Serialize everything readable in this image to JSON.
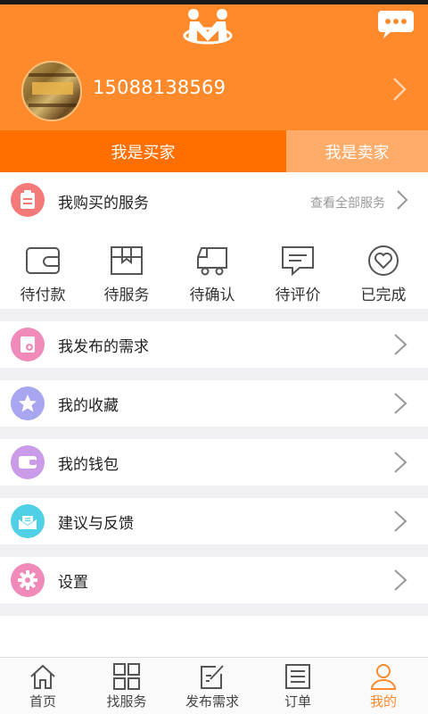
{
  "header": {
    "phone": "15088138569"
  },
  "role_tabs": [
    {
      "label": "我是买家",
      "active": true
    },
    {
      "label": "我是卖家",
      "active": false
    }
  ],
  "purchased": {
    "title": "我购买的服务",
    "view_all": "查看全部服务"
  },
  "status_items": [
    {
      "label": "待付款",
      "icon": "wallet-icon"
    },
    {
      "label": "待服务",
      "icon": "package-icon"
    },
    {
      "label": "待确认",
      "icon": "truck-icon"
    },
    {
      "label": "待评价",
      "icon": "comment-icon"
    },
    {
      "label": "已完成",
      "icon": "heart-check-icon"
    }
  ],
  "menu": [
    {
      "label": "我发布的需求",
      "icon": "publish-icon",
      "color": "#f08bb9"
    },
    {
      "label": "我的收藏",
      "icon": "star-icon",
      "color": "#a8a6f0"
    },
    {
      "label": "我的钱包",
      "icon": "wallet-icon",
      "color": "#c99be8"
    },
    {
      "label": "建议与反馈",
      "icon": "mail-icon",
      "color": "#4fd0e6"
    },
    {
      "label": "设置",
      "icon": "gear-icon",
      "color": "#f08bb9"
    }
  ],
  "bottom_nav": [
    {
      "label": "首页",
      "icon": "home-icon",
      "active": false
    },
    {
      "label": "找服务",
      "icon": "grid-icon",
      "active": false
    },
    {
      "label": "发布需求",
      "icon": "edit-icon",
      "active": false
    },
    {
      "label": "订单",
      "icon": "list-icon",
      "active": false
    },
    {
      "label": "我的",
      "icon": "user-icon",
      "active": true
    }
  ],
  "colors": {
    "accent": "#ff8a2b",
    "buyer_tab": "#ff6f00",
    "seller_tab": "#ffab6a"
  }
}
